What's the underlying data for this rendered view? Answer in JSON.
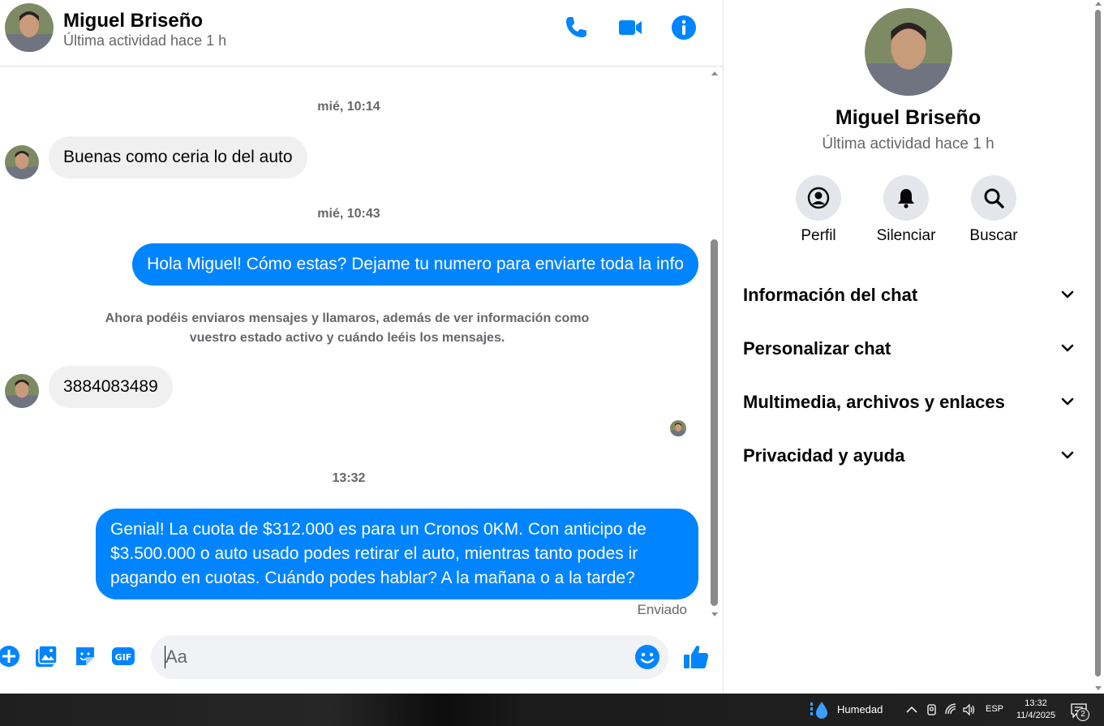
{
  "header": {
    "name": "Miguel Briseño",
    "status": "Última actividad hace 1 h",
    "icons": [
      "phone-icon",
      "video-icon",
      "info-icon"
    ]
  },
  "messages": {
    "time1": "mié, 10:14",
    "msg1": "Buenas como ceria lo del auto",
    "time2": "mié, 10:43",
    "msg2": "Hola Miguel! Cómo estas? Dejame tu numero para enviarte toda la info",
    "system_note": "Ahora podéis enviaros mensajes y llamaros, además de ver información como vuestro estado activo y cuándo leéis los mensajes.",
    "msg3": "3884083489",
    "time3": "13:32",
    "msg4": "Genial! La cuota de $312.000 es para un Cronos 0KM. Con anticipo de $3.500.000 o auto usado podes retirar el auto, mientras tanto podes ir pagando en cuotas. Cuándo podes hablar? A la mañana o a la tarde?",
    "sent_status": "Enviado"
  },
  "composer": {
    "placeholder": "Aa",
    "icons": [
      "plus-icon",
      "photo-icon",
      "sticker-icon",
      "gif-icon",
      "emoji-icon",
      "like-icon"
    ]
  },
  "info_panel": {
    "name": "Miguel Briseño",
    "status": "Última actividad hace 1 h",
    "actions": [
      {
        "label": "Perfil",
        "icon": "profile-icon"
      },
      {
        "label": "Silenciar",
        "icon": "bell-icon"
      },
      {
        "label": "Buscar",
        "icon": "search-icon"
      }
    ],
    "sections": [
      "Información del chat",
      "Personalizar chat",
      "Multimedia, archivos y enlaces",
      "Privacidad y ayuda"
    ]
  },
  "taskbar": {
    "weather": "Humedad",
    "lang": "ESP",
    "time": "13:32",
    "date": "11/4/2025",
    "notifications": "2"
  },
  "colors": {
    "accent": "#0084ff",
    "incoming_bubble": "#f0f0f0",
    "muted_text": "#65676b"
  }
}
